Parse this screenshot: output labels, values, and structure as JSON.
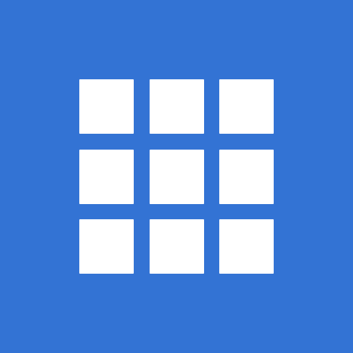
{
  "icon": {
    "name": "app-grid-icon",
    "background_color": "#3373D4",
    "tile_color": "#FFFFFF",
    "grid": {
      "rows": 3,
      "columns": 3
    }
  }
}
